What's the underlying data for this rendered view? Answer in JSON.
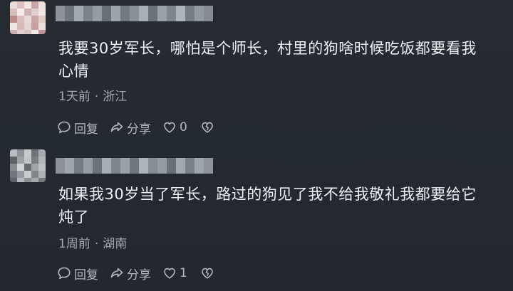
{
  "comments": [
    {
      "text_line1": "我要30岁军长，哪怕是个师长，村里的狗啥时候吃饭都要看我",
      "text_line2": "心情",
      "time": "1天前",
      "separator": "·",
      "location": "浙江",
      "reply_label": "回复",
      "share_label": "分享",
      "like_count": "0",
      "avatar_icon": "avatar-pixelated",
      "avatar_colors": [
        "#e8dcd8",
        "#d9c2bf",
        "#f3e6e4",
        "#c9a9a8",
        "#ece2e0",
        "#d6bebb",
        "#f6ecea",
        "#cfb2af",
        "#e0cecb",
        "#f1e3e1",
        "#b98c8a",
        "#d8bfbc",
        "#e9dad8",
        "#c8a7a5",
        "#dfcac7",
        "#f0e6e4",
        "#d4b9b6",
        "#e6d4d2",
        "#c4a19e",
        "#ecdedc",
        "#cbb0ad",
        "#e3d1cf",
        "#dac4c1",
        "#f4eae8",
        "#bf9694"
      ],
      "username_colors": [
        "#8d939b",
        "#6f757d",
        "#a4aab1",
        "#7d838b",
        "#959ba3",
        "#687077",
        "#9ea4ab",
        "#747a82",
        "#8a9098",
        "#a9afb6",
        "#6c7279",
        "#99a0a7",
        "#80868e",
        "#b0b5bc",
        "#777d85",
        "#9299a0",
        "#858b93"
      ]
    },
    {
      "text_line1": "如果我30岁当了军长，路过的狗见了我不给我敬礼我都要给它",
      "text_line2": "炖了",
      "time": "1周前",
      "separator": "·",
      "location": "湖南",
      "reply_label": "回复",
      "share_label": "分享",
      "like_count": "1",
      "avatar_icon": "avatar-pixelated",
      "avatar_colors": [
        "#b9bcc0",
        "#8f9398",
        "#c6c9cc",
        "#6f7378",
        "#a7aaae",
        "#5e6267",
        "#9da0a4",
        "#c2c5c8",
        "#7a7e83",
        "#b1b4b8",
        "#888c91",
        "#d0d2d5",
        "#686c71",
        "#a0a3a7",
        "#bcbfc3",
        "#73777c",
        "#9599a0",
        "#c9cbce",
        "#81858a",
        "#aeb1b5",
        "#60646a",
        "#b6b9bd",
        "#8c9095",
        "#a4a7ab",
        "#777b80"
      ],
      "username_colors": [
        "#8b9198",
        "#a0a6ad",
        "#767c84",
        "#979da4",
        "#6d737b",
        "#a8aeb5",
        "#80868e",
        "#9ba1a8",
        "#71777f",
        "#adb3ba",
        "#878d95",
        "#959ba2",
        "#6a7078",
        "#a3a9b0",
        "#7b8189",
        "#9fa5ac",
        "#8e949b"
      ]
    }
  ]
}
